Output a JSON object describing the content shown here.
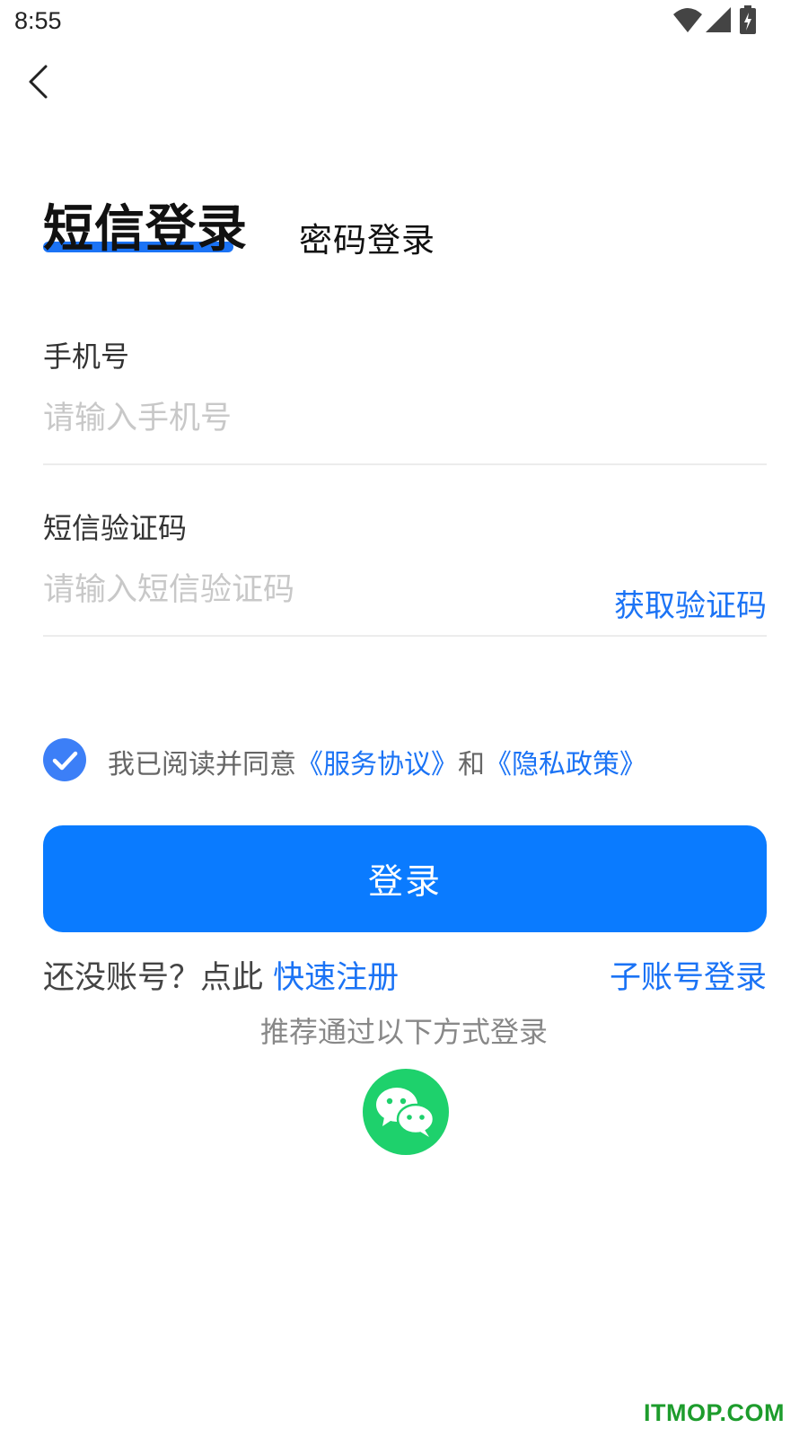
{
  "status_bar": {
    "time": "8:55"
  },
  "tabs": {
    "sms": "短信登录",
    "password": "密码登录",
    "active": "sms"
  },
  "phone": {
    "label": "手机号",
    "placeholder": "请输入手机号",
    "value": ""
  },
  "sms_code": {
    "label": "短信验证码",
    "placeholder": "请输入短信验证码",
    "value": "",
    "get_code": "获取验证码"
  },
  "agreement": {
    "checked": true,
    "prefix": "我已阅读并同意",
    "service_link": "《服务协议》",
    "and": "和",
    "privacy_link": "《隐私政策》"
  },
  "login_button": "登录",
  "register": {
    "prompt": "还没账号？点此",
    "link": "快速注册"
  },
  "sub_account_login": "子账号登录",
  "alt_login": {
    "hint": "推荐通过以下方式登录",
    "icon": "wechat-icon"
  },
  "watermark": "ITMOP.COM",
  "colors": {
    "accent": "#0a7bff",
    "link": "#1b73f5",
    "wechat": "#1ed16c"
  }
}
